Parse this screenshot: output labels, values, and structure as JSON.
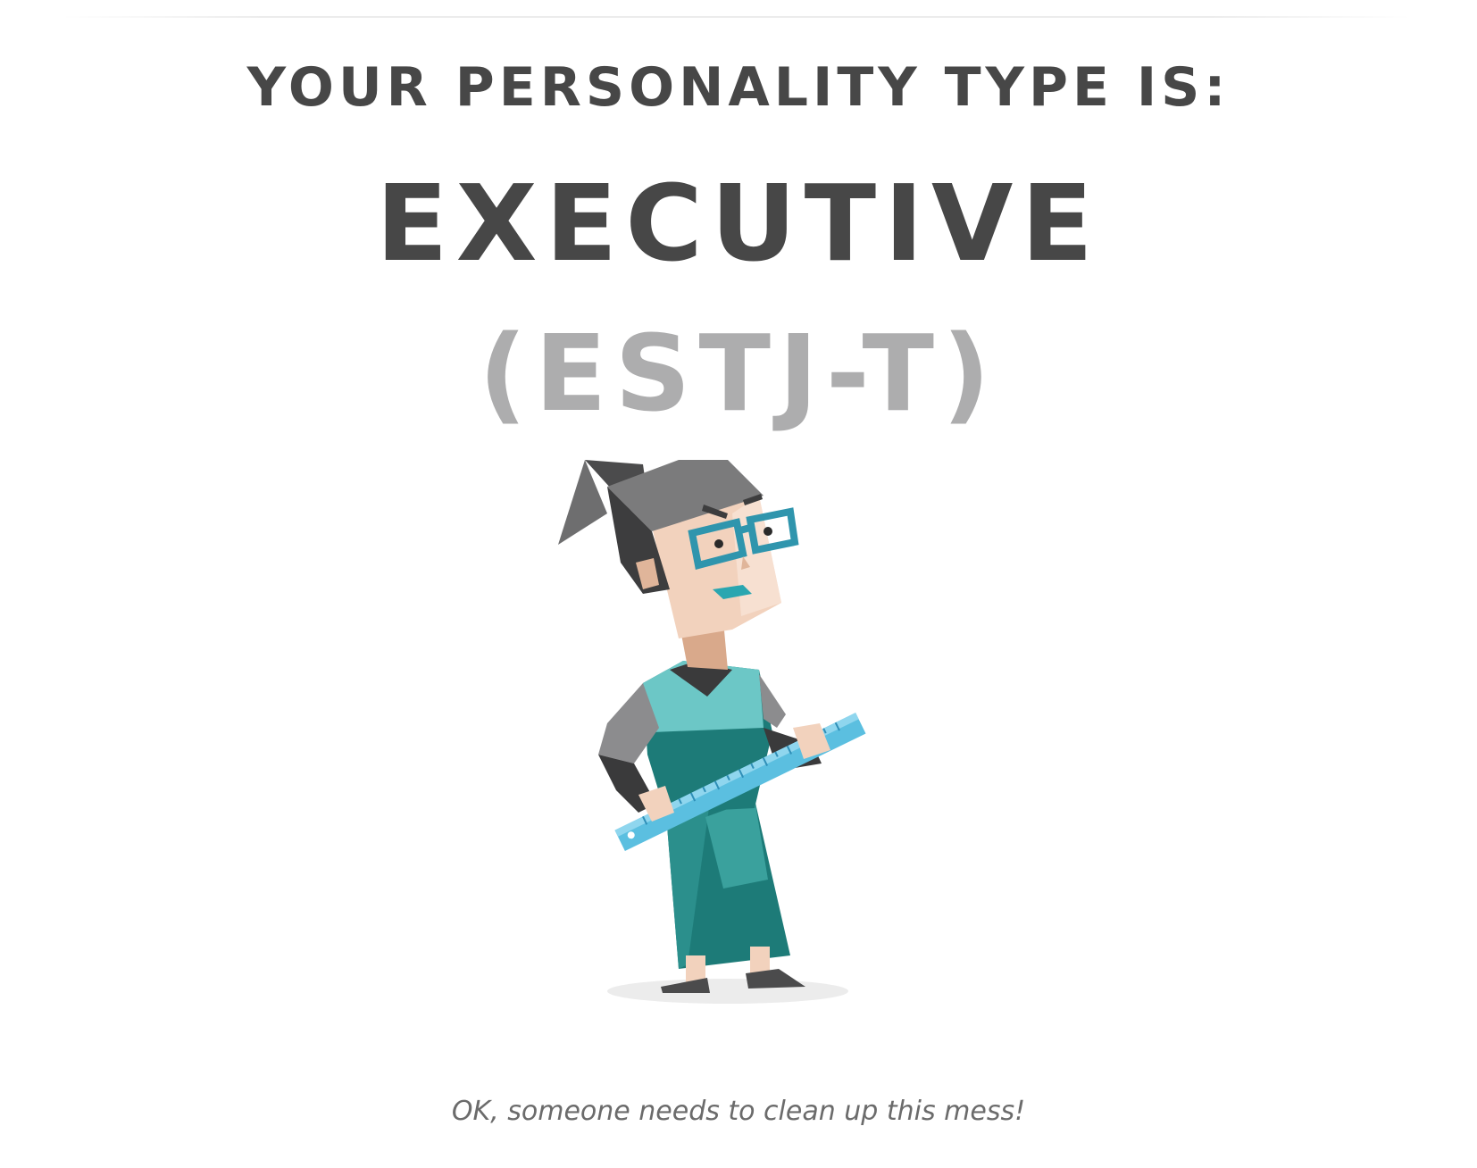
{
  "result": {
    "intro": "YOUR PERSONALITY TYPE IS:",
    "type_name": "EXECUTIVE",
    "type_code": "(ESTJ-T)",
    "tagline": "OK, someone needs to clean up this mess!"
  },
  "illustration": {
    "subject": "executive-character-with-ruler",
    "colors": {
      "hair": "#4b4b4c",
      "skin": "#f2d2bd",
      "glasses": "#2f95ad",
      "dress_light": "#6cc7c6",
      "dress_dark": "#1d7b78",
      "ruler": "#5bbfe0"
    }
  },
  "theme": {
    "text_dark": "#474747",
    "text_muted": "#adadae",
    "background": "#ffffff"
  }
}
